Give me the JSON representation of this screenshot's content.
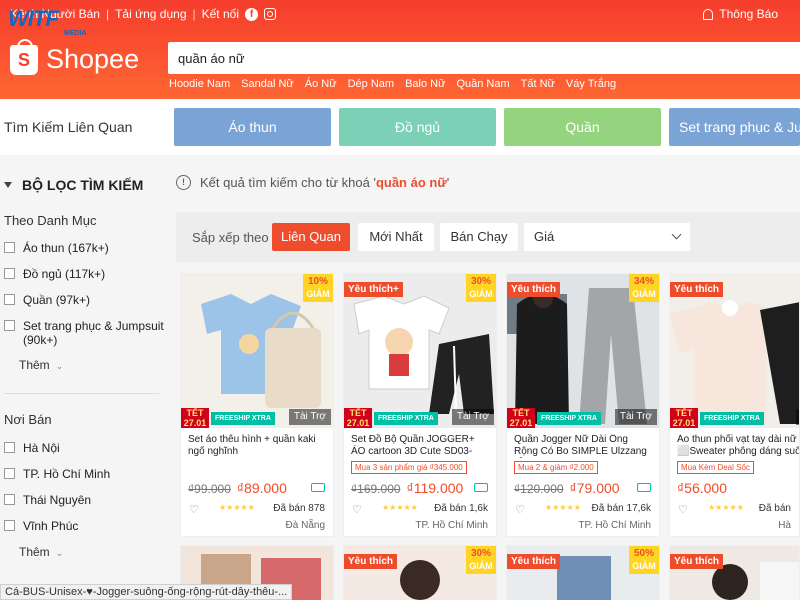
{
  "header": {
    "topbar_items": [
      "Kênh Người Bán",
      "Tải ứng dụng",
      "Kết nối"
    ],
    "notification_label": "Thông Báo",
    "logo_text": "Shopee",
    "watermark_big": "WITF",
    "watermark_small": "MEDIA",
    "search_value": "quần áo nữ",
    "suggestions": [
      "Hoodie Nam",
      "Sandal Nữ",
      "Áo Nữ",
      "Dép Nam",
      "Balo Nữ",
      "Quần Nam",
      "Tất Nữ",
      "Váy Trắng"
    ]
  },
  "related": {
    "label": "Tìm Kiếm Liên Quan",
    "pills": [
      {
        "label": "Áo thun",
        "color": "#7aa3d6"
      },
      {
        "label": "Đồ ngủ",
        "color": "#7cd0b6"
      },
      {
        "label": "Quần",
        "color": "#95d47e"
      },
      {
        "label": "Set trang phục & Jumpsuit",
        "color": "#7aa3d6"
      }
    ]
  },
  "sidebar": {
    "title": "BỘ LỌC TÌM KIẾM",
    "category_title": "Theo Danh Mục",
    "categories": [
      "Áo thun (167k+)",
      "Đồ ngủ (117k+)",
      "Quần (97k+)",
      "Set trang phục & Jumpsuit (90k+)"
    ],
    "more_label": "Thêm",
    "seller_title": "Nơi Bán",
    "locations": [
      "Hà Nội",
      "TP. Hồ Chí Minh",
      "Thái Nguyên",
      "Vĩnh Phúc"
    ]
  },
  "result": {
    "prefix": "Kết quả tìm kiếm cho từ khoá '",
    "query": "quần áo nữ",
    "suffix": "'"
  },
  "sort": {
    "label": "Sắp xếp theo",
    "options": [
      "Liên Quan",
      "Mới Nhất",
      "Bán Chạy"
    ],
    "price_label": "Giá"
  },
  "products": [
    {
      "name": "Set áo thêu hình + quần kaki ngố nghĩnh",
      "fav": "",
      "discount": "10%",
      "disc_word": "GIẢM",
      "tet": "TẾT 27.01",
      "freeship": "FREESHIP XTRA",
      "ad": "Tài Trợ",
      "promo": "",
      "old_price": "₫99.000",
      "price": "₫89.000",
      "rating": "★★★★★",
      "sold": "Đã bán 878",
      "location": "Đà Nẵng"
    },
    {
      "name": "Set Đồ Bộ Quần JOGGER+ ÁO cartoon 3D Cute SD03-Lapi VN",
      "fav": "Yêu thích+",
      "discount": "30%",
      "disc_word": "GIẢM",
      "tet": "TẾT 27.01",
      "freeship": "FREESHIP XTRA",
      "ad": "Tài Trợ",
      "promo": "Mua 3 sản phẩm giá ₫345.000",
      "old_price": "₫169.000",
      "price": "₫119.000",
      "rating": "★★★★★",
      "sold": "Đã bán 1,6k",
      "location": "TP. Hồ Chí Minh"
    },
    {
      "name": "Quần Jogger Nữ Dài Ống Rộng Có Bo SIMPLE Ulzzang (ẢN...",
      "fav": "Yêu thích",
      "discount": "34%",
      "disc_word": "GIẢM",
      "tet": "TẾT 27.01",
      "freeship": "FREESHIP XTRA",
      "ad": "Tài Trợ",
      "promo": "Mua 2 & giảm ₫2.000",
      "old_price": "₫120.000",
      "price": "₫79.000",
      "rating": "★★★★★",
      "sold": "Đã bán 17,6k",
      "location": "TP. Hồ Chí Minh"
    },
    {
      "name": "Áo thun phối vạt tay dài nữ - ⬜Sweater phông dáng suôn...",
      "fav": "Yêu thích",
      "discount": "",
      "disc_word": "",
      "tet": "TẾT 27.01",
      "freeship": "FREESHIP XTRA",
      "ad": "Tài",
      "promo": "Mua Kèm Deal Sốc",
      "old_price": "",
      "price": "₫56.000",
      "rating": "★★★★★",
      "sold": "Đã bán",
      "location": "Hà"
    }
  ],
  "second_row": [
    {
      "fav": "",
      "discount": "",
      "disc_word": ""
    },
    {
      "fav": "Yêu thích",
      "discount": "30%",
      "disc_word": "GIẢM"
    },
    {
      "fav": "Yêu thích",
      "discount": "50%",
      "disc_word": "GIẢM"
    },
    {
      "fav": "Yêu thích",
      "discount": "",
      "disc_word": ""
    }
  ],
  "statusbar": "Cá-BUS-Unisex-♥-Jogger-suông-ống-rộng-rút-dây-thêu-..."
}
